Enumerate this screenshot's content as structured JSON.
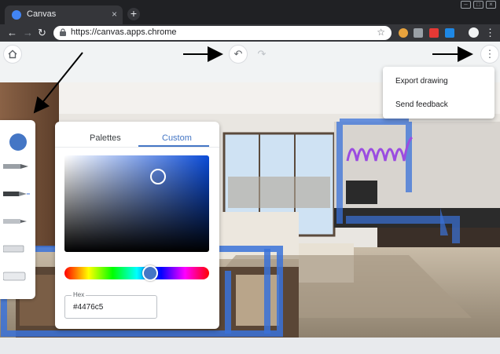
{
  "browser": {
    "tab_title": "Canvas",
    "tab_close": "×",
    "new_tab": "+",
    "url": "https://canvas.apps.chrome",
    "window_controls": [
      "–",
      "□",
      "×"
    ]
  },
  "app": {
    "home_icon": "home-icon",
    "undo_icon": "undo-icon",
    "redo_icon": "redo-icon",
    "more_icon": "more-vert-icon"
  },
  "tools": {
    "selected_color": "#4476c5",
    "items": [
      "pencil-icon",
      "pen-icon",
      "marker-icon",
      "chalk-icon",
      "eraser-icon"
    ]
  },
  "color_picker": {
    "tabs": [
      "Palettes",
      "Custom"
    ],
    "active_tab": "Custom",
    "hex_label": "Hex",
    "hex_value": "#4476c5",
    "hue_position": 0.59
  },
  "menu": {
    "items": [
      "Export drawing",
      "Send feedback"
    ]
  },
  "colors": {
    "accent": "#4476c5",
    "tool_highlight": "#3a72d9",
    "drawing_purple": "#9b4de0"
  }
}
